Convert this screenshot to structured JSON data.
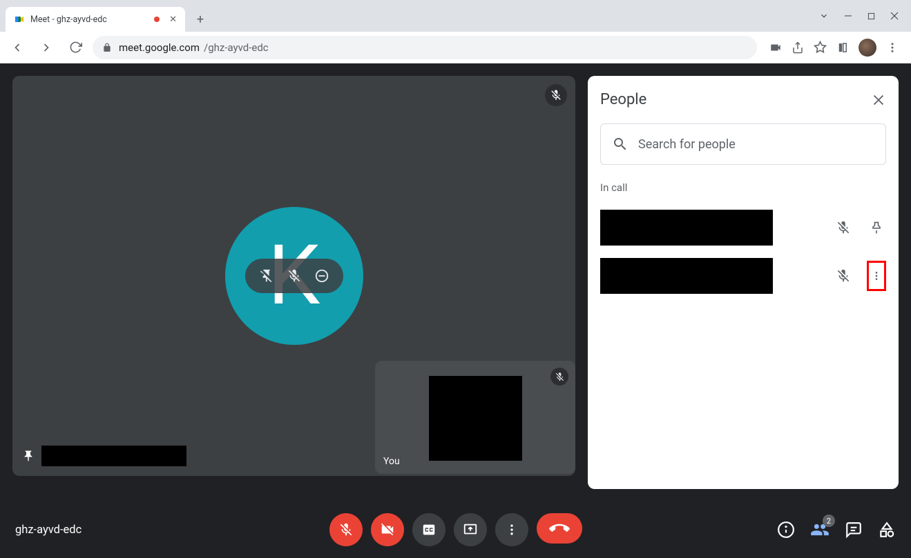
{
  "browser": {
    "tab_title": "Meet - ghz-ayvd-edc",
    "url_host": "meet.google.com",
    "url_path": "/ghz-ayvd-edc"
  },
  "main_tile": {
    "avatar_letter": "K"
  },
  "self_tile": {
    "label": "You"
  },
  "bottom_bar": {
    "meeting_code": "ghz-ayvd-edc",
    "people_count": "2"
  },
  "side_panel": {
    "title": "People",
    "search_placeholder": "Search for people",
    "in_call_label": "In call"
  }
}
